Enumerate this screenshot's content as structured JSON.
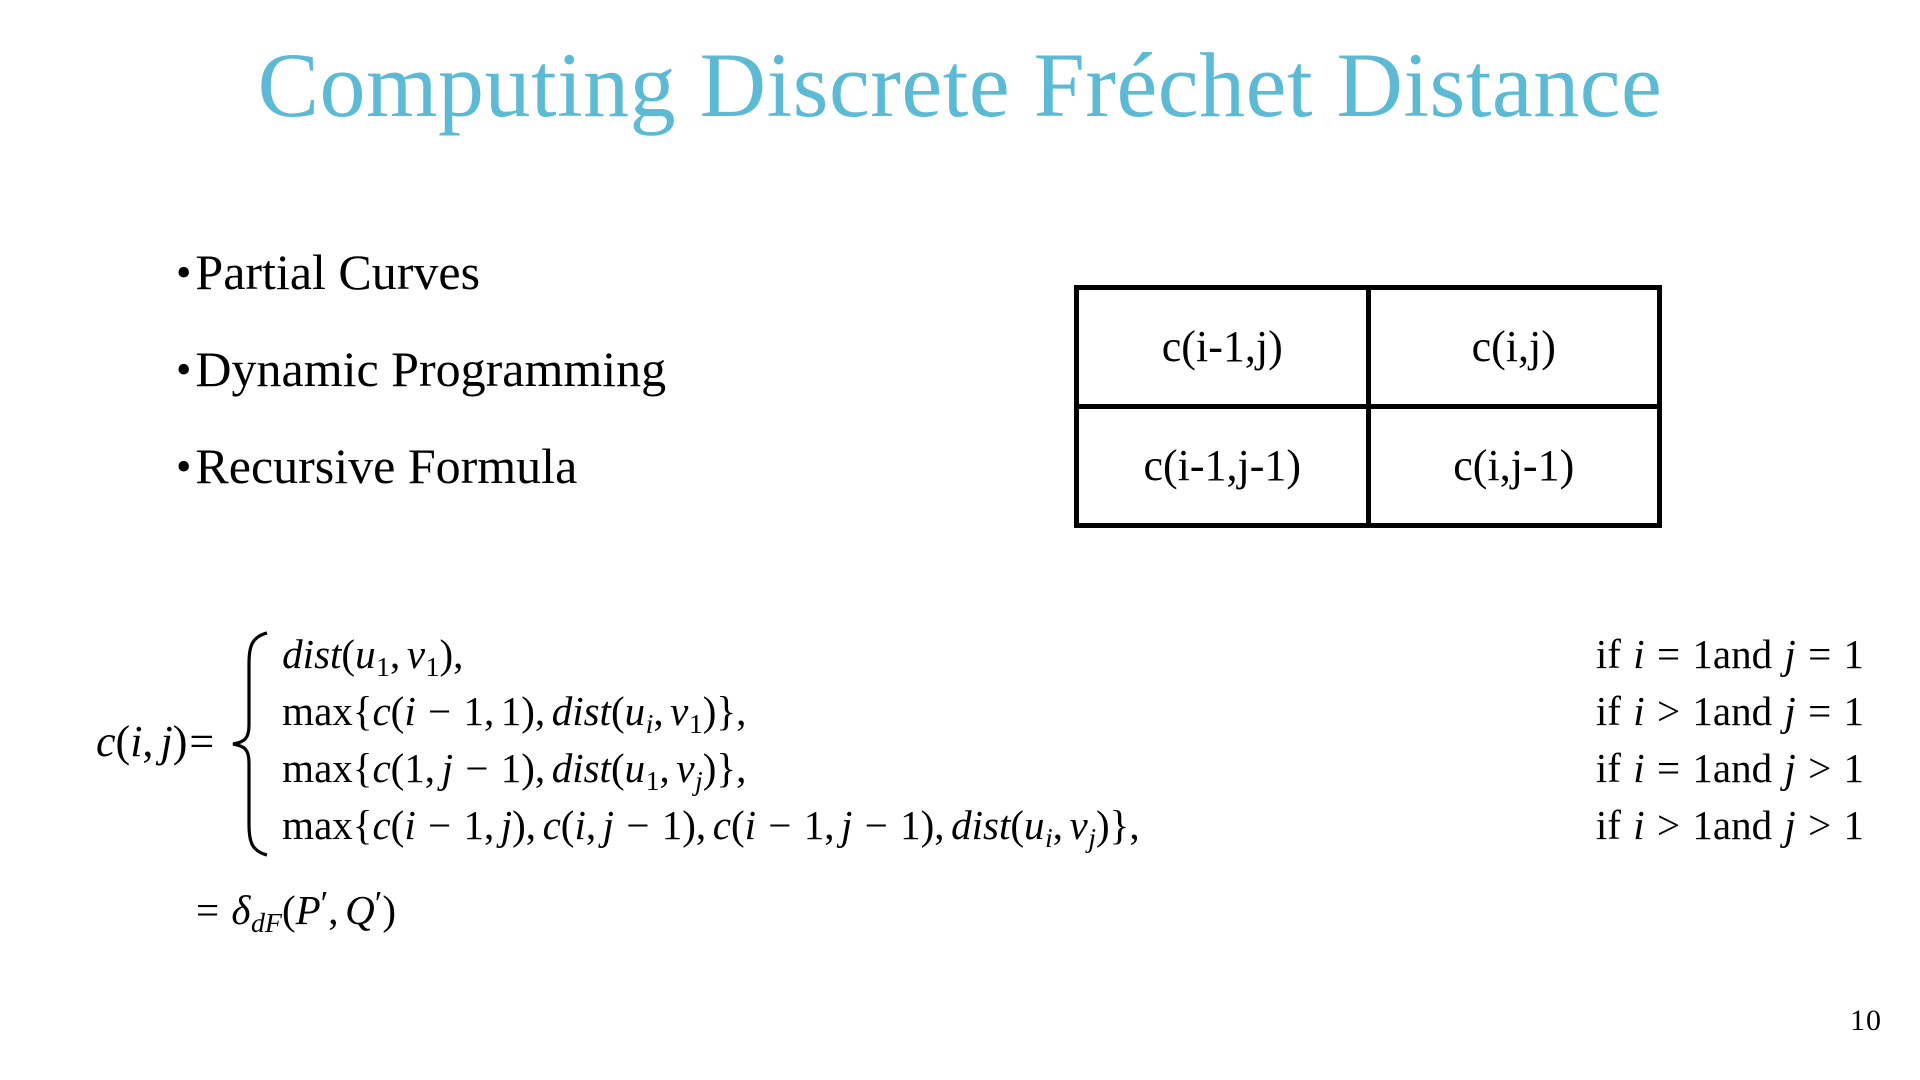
{
  "slide": {
    "title": "Computing Discrete Fréchet Distance",
    "title_color": "#5cbad4",
    "background_color": "#ffffff",
    "page_number": "10"
  },
  "bullets": {
    "marker": "•",
    "items": [
      {
        "label": "Partial Curves"
      },
      {
        "label": "Dynamic Programming"
      },
      {
        "label": "Recursive Formula"
      }
    ]
  },
  "dp_table": {
    "rows": [
      [
        {
          "value": "c(i-1,j)"
        },
        {
          "value": "c(i,j)"
        }
      ],
      [
        {
          "value": "c(i-1,j-1)"
        },
        {
          "value": "c(i,j-1)"
        }
      ]
    ]
  },
  "formula": {
    "lhs_function": "c",
    "lhs_open": "(",
    "lhs_arg1": "i",
    "lhs_comma": ",",
    "lhs_arg2": "j",
    "lhs_close": ")",
    "lhs_equals": "=",
    "cases": [
      {
        "expression": "dist(u_1, v_1),",
        "expression_plain": "dist(u1, v1),",
        "condition": "if i = 1and j = 1"
      },
      {
        "expression": "max{c(i − 1, 1), dist(u_i, v_1)},",
        "expression_plain": "max{c(i - 1, 1), dist(ui, v1)},",
        "condition": "if i > 1and j = 1"
      },
      {
        "expression": "max{c(1, j − 1), dist(u_1, v_j)},",
        "expression_plain": "max{c(1, j - 1), dist(u1, vj)},",
        "condition": "if i = 1and j > 1"
      },
      {
        "expression": "max{c(i − 1, j), c(i, j − 1), c(i − 1, j − 1), dist(u_i, v_j)},",
        "expression_plain": "max{c(i - 1, j), c(i, j - 1), c(i - 1, j - 1), dist(ui, vj)},",
        "condition": "if i > 1and j > 1"
      }
    ],
    "final_line": "= δ_dF(P′, Q′)",
    "final_line_plain": "= delta_dF(P', Q')"
  }
}
